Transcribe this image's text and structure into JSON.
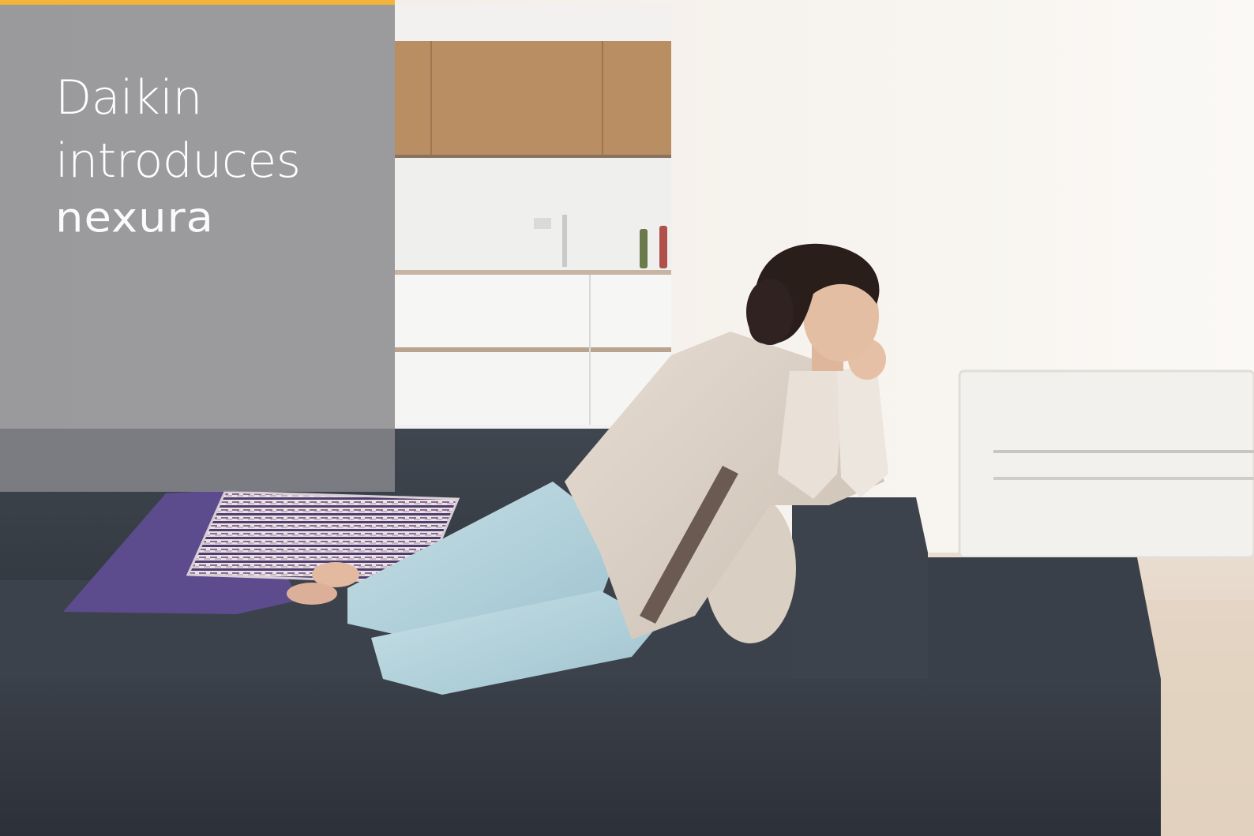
{
  "hero": {
    "headline_line1": "Daikin",
    "headline_line2": "introduces",
    "product_name": "nexura"
  },
  "colors": {
    "accent": "#f4b43a",
    "panel": "#87898e",
    "sofa": "#3a3f47",
    "wall": "#f5f1ec"
  },
  "image": {
    "subject": "woman-relaxing-on-sofa-photo"
  }
}
